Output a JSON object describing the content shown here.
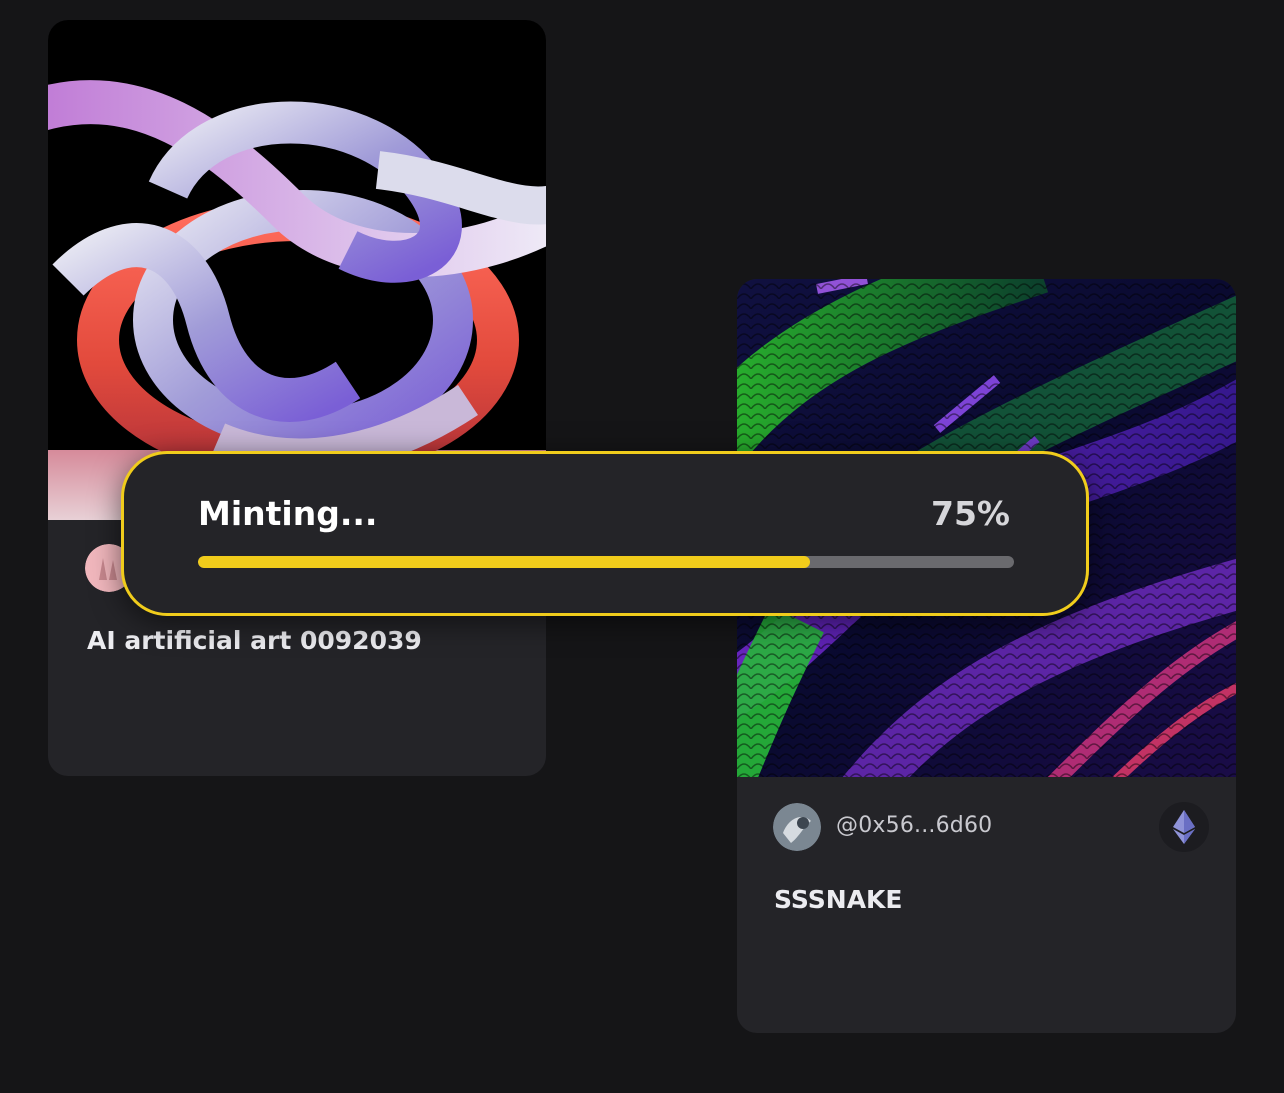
{
  "colors": {
    "background": "#151517",
    "card": "#242428",
    "accent": "#f0cc1c",
    "progress_track": "#6a6a6e"
  },
  "cards": [
    {
      "art_icon": "abstract-knot-artwork",
      "avatar_icon": "pink-avatar",
      "title": "AI artificial art 0092039"
    },
    {
      "art_icon": "snake-scales-artwork",
      "avatar_icon": "owner-avatar",
      "owner": "@0x56...6d60",
      "chain_icon": "ethereum-icon",
      "title": "SSSNAKE"
    }
  ],
  "minting": {
    "label": "Minting...",
    "percent_label": "75%",
    "progress": 0.75
  }
}
